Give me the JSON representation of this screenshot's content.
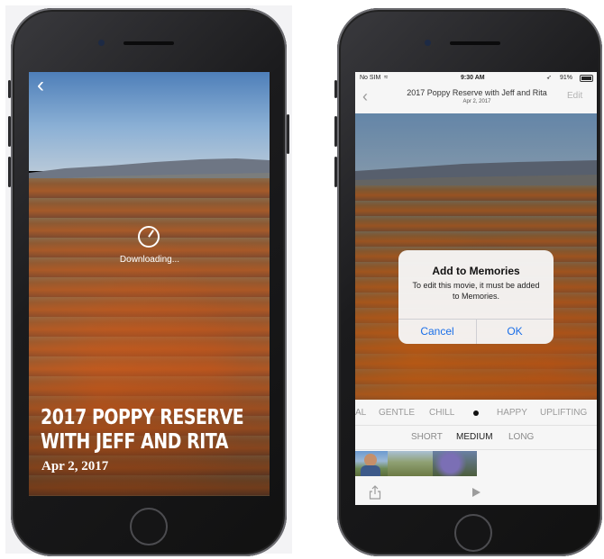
{
  "phone1": {
    "back_glyph": "‹",
    "status_text": "Downloading...",
    "movie_title": "2017 POPPY RESERVE\nWITH JEFF AND RITA",
    "movie_date": "Apr 2, 2017"
  },
  "phone2": {
    "status": {
      "carrier": "No SIM",
      "time": "9:30 AM",
      "battery": "91%"
    },
    "nav": {
      "back_glyph": "‹",
      "title": "2017 Poppy Reserve with Jeff and Rita",
      "subtitle": "Apr 2, 2017",
      "edit_label": "Edit"
    },
    "dialog": {
      "title": "Add to Memories",
      "message": "To edit this movie, it must be added to Memories.",
      "cancel_label": "Cancel",
      "ok_label": "OK"
    },
    "moods": [
      "AL",
      "GENTLE",
      "CHILL",
      "HAPPY",
      "UPLIFTING"
    ],
    "lengths": [
      "SHORT",
      "MEDIUM",
      "LONG"
    ],
    "selected_length": "MEDIUM",
    "icons": {
      "share": "share-icon",
      "play": "play-icon"
    }
  },
  "colors": {
    "accent": "#1a6fe8",
    "poppy": "#d2591c"
  }
}
